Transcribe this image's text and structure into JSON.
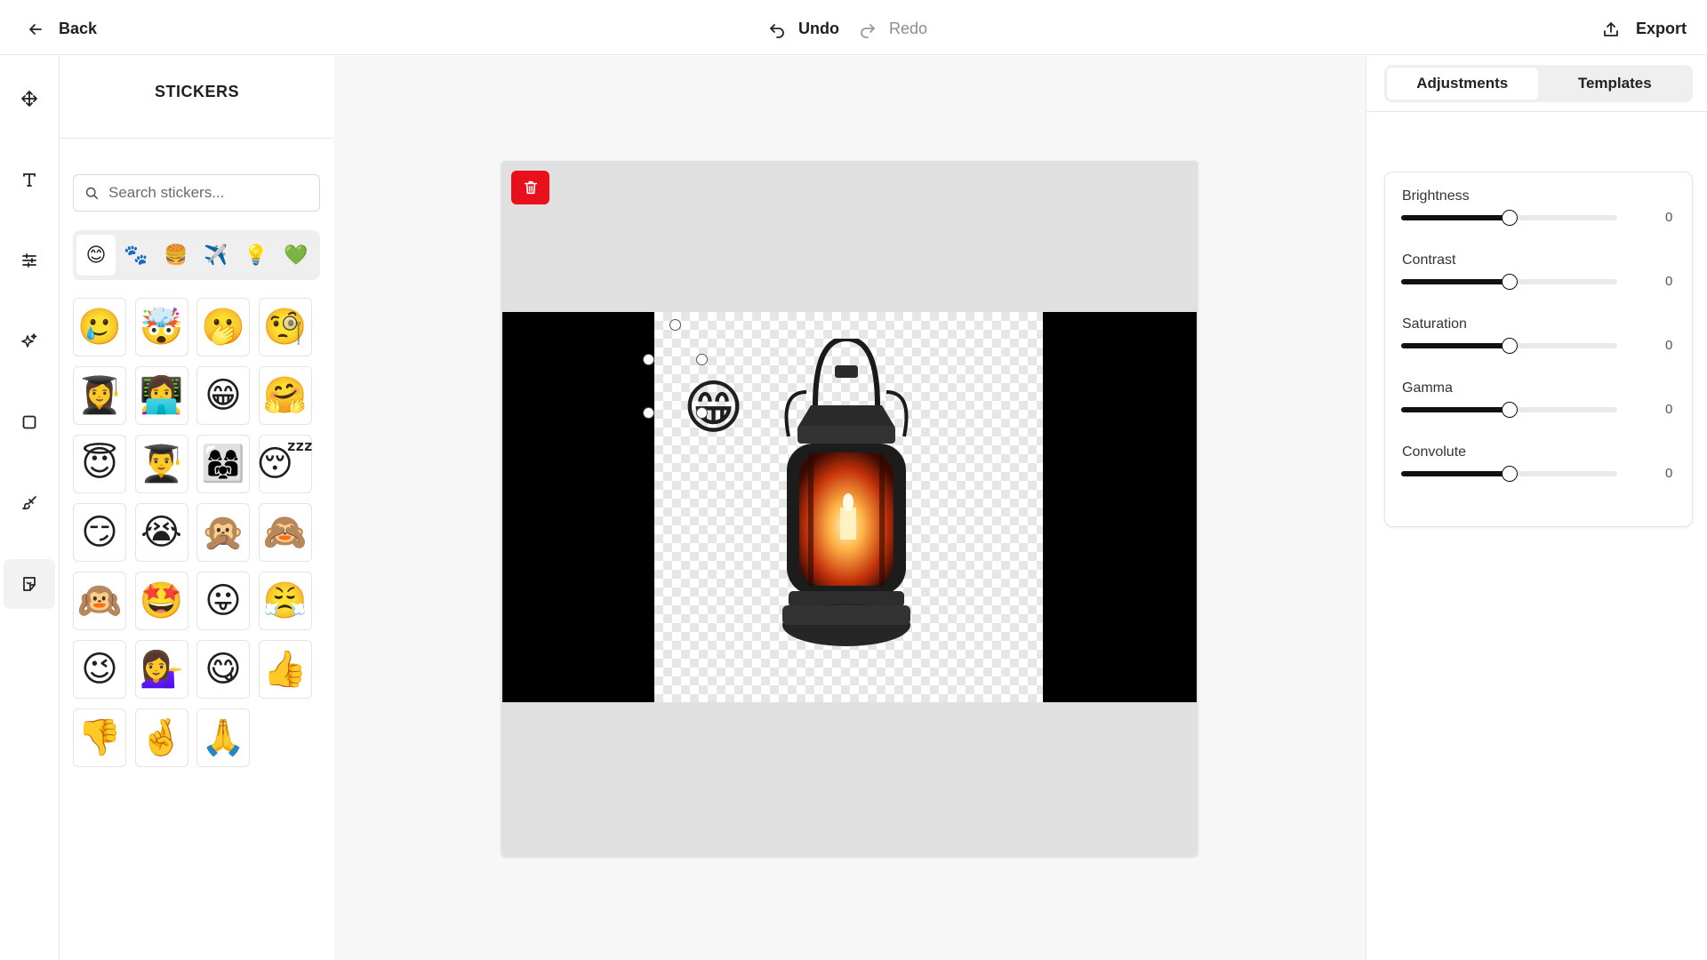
{
  "topbar": {
    "back_label": "Back",
    "undo_label": "Undo",
    "redo_label": "Redo",
    "export_label": "Export"
  },
  "rail": {
    "items": [
      {
        "icon": "move-icon"
      },
      {
        "icon": "text-icon"
      },
      {
        "icon": "sliders-icon"
      },
      {
        "icon": "sparkles-icon"
      },
      {
        "icon": "square-icon"
      },
      {
        "icon": "brush-icon"
      },
      {
        "icon": "sticker-icon",
        "active": true
      }
    ]
  },
  "stickers": {
    "title": "STICKERS",
    "search_placeholder": "Search stickers...",
    "categories": [
      "😊",
      "🐾",
      "🍔",
      "✈️",
      "💡",
      "💚"
    ],
    "active_category": 0,
    "items": [
      "🥲",
      "🤯",
      "🫢",
      "🧐",
      "👩‍🎓",
      "👩‍💻",
      "😁",
      "🤗",
      "😇",
      "👨‍🎓",
      "👩‍👩‍👧",
      "😴",
      "😏",
      "😭",
      "🙊",
      "🙈",
      "🙉",
      "🤩",
      "😛",
      "😤",
      "😉",
      "💁‍♀️",
      "😋",
      "👍",
      "👎",
      "🤞",
      "🙏"
    ]
  },
  "canvas": {
    "selected_sticker": "😁",
    "delete_icon": "trash-icon"
  },
  "right_panel": {
    "tabs": [
      "Adjustments",
      "Templates"
    ],
    "active_tab": 0,
    "adjustments": [
      {
        "label": "Brightness",
        "value": "0",
        "level": 0.5
      },
      {
        "label": "Contrast",
        "value": "0",
        "level": 0.5
      },
      {
        "label": "Saturation",
        "value": "0",
        "level": 0.5
      },
      {
        "label": "Gamma",
        "value": "0",
        "level": 0.5
      },
      {
        "label": "Convolute",
        "value": "0",
        "level": 0.5
      }
    ]
  },
  "colors": {
    "delete_button": "#e8101c",
    "slider_fill": "#111111",
    "canvas_bg": "#e0e0e0"
  }
}
